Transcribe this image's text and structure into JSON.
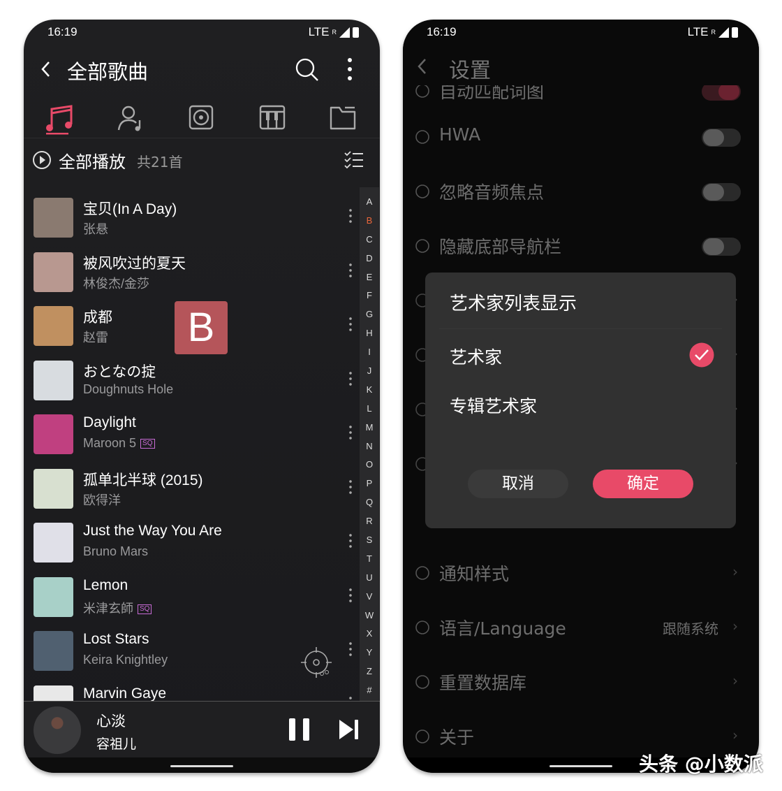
{
  "left": {
    "status": {
      "time": "16:19",
      "network": "LTE",
      "roaming": "R"
    },
    "title": "全部歌曲",
    "tabs": [
      {
        "icon": "music-note-icon",
        "active": true
      },
      {
        "icon": "artist-icon"
      },
      {
        "icon": "album-icon"
      },
      {
        "icon": "piano-icon"
      },
      {
        "icon": "folder-icon"
      }
    ],
    "play_all": {
      "label": "全部播放",
      "count": "共21首"
    },
    "accent": "#e84a68",
    "songs": [
      {
        "title": "宝贝(In A Day)",
        "artist": "张悬",
        "color": "#8a7a70"
      },
      {
        "title": "被风吹过的夏天",
        "artist": "林俊杰/金莎",
        "color": "#b89890"
      },
      {
        "title": "成都",
        "artist": "赵雷",
        "color": "#c09060"
      },
      {
        "title": "おとなの掟",
        "artist": "Doughnuts Hole",
        "color": "#d8dce0"
      },
      {
        "title": "Daylight",
        "artist": "Maroon 5",
        "sq": "SQ",
        "color": "#c04080"
      },
      {
        "title": "孤单北半球 (2015)",
        "artist": "欧得洋",
        "color": "#d8e0d0"
      },
      {
        "title": "Just the Way You Are",
        "artist": "Bruno Mars",
        "color": "#e0e0e8"
      },
      {
        "title": "Lemon",
        "artist": "米津玄師",
        "sq": "SQ",
        "color": "#a8d0c8"
      },
      {
        "title": "Lost Stars",
        "artist": "Keira Knightley",
        "color": "#506070"
      },
      {
        "title": "Marvin Gaye",
        "artist": "",
        "color": "#e8e8e8"
      }
    ],
    "index_letters": [
      "A",
      "B",
      "C",
      "D",
      "E",
      "F",
      "G",
      "H",
      "I",
      "J",
      "K",
      "L",
      "M",
      "N",
      "O",
      "P",
      "Q",
      "R",
      "S",
      "T",
      "U",
      "V",
      "W",
      "X",
      "Y",
      "Z",
      "#"
    ],
    "active_letter": "B",
    "letter_popup": "B",
    "now_playing": {
      "title": "心淡",
      "artist": "容祖儿"
    }
  },
  "right": {
    "status": {
      "time": "16:19",
      "network": "LTE",
      "roaming": "R"
    },
    "title": "设置",
    "settings": [
      {
        "label": "自动匹配词图",
        "icon": "lyrics-icon",
        "type": "toggle-on"
      },
      {
        "label": "HWA",
        "icon": "bluetooth-headphones-icon",
        "type": "toggle"
      },
      {
        "label": "忽略音频焦点",
        "icon": "circles-icon",
        "type": "toggle"
      },
      {
        "label": "隐藏底部导航栏",
        "icon": "navbar-icon",
        "type": "toggle"
      },
      {
        "label": "通知样式",
        "icon": "message-icon",
        "type": "chevron"
      },
      {
        "label": "语言/Language",
        "icon": "globe-icon",
        "value": "跟随系统",
        "type": "chevron"
      },
      {
        "label": "重置数据库",
        "icon": "refresh-icon",
        "type": "chevron"
      },
      {
        "label": "关于",
        "icon": "info-icon",
        "type": "chevron"
      }
    ],
    "dialog": {
      "title": "艺术家列表显示",
      "options": [
        {
          "label": "艺术家",
          "selected": true
        },
        {
          "label": "专辑艺术家",
          "selected": false
        }
      ],
      "cancel": "取消",
      "confirm": "确定"
    }
  },
  "watermark": "头条 @小数派"
}
